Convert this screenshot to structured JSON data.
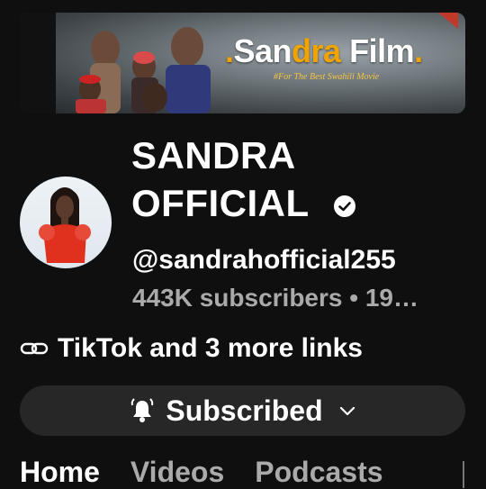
{
  "banner": {
    "brand_prefix": ".",
    "brand_part1": "San",
    "brand_part2": "dra",
    "brand_part3": " Film",
    "brand_suffix": ".",
    "tagline": "#For The Best Swahili Movie"
  },
  "channel": {
    "name_line1": "SANDRA",
    "name_line2": "OFFICIAL",
    "handle": "@sandrahofficial255",
    "meta": "443K subscribers • 19…"
  },
  "links": {
    "text": "TikTok and 3 more links"
  },
  "subscribe": {
    "label": "Subscribed"
  },
  "tabs": [
    "Home",
    "Videos",
    "Podcasts"
  ],
  "colors": {
    "background": "#0f0f0f",
    "button": "#272727",
    "muted": "#aaaaaa",
    "brand_accent": "#f0a400"
  }
}
